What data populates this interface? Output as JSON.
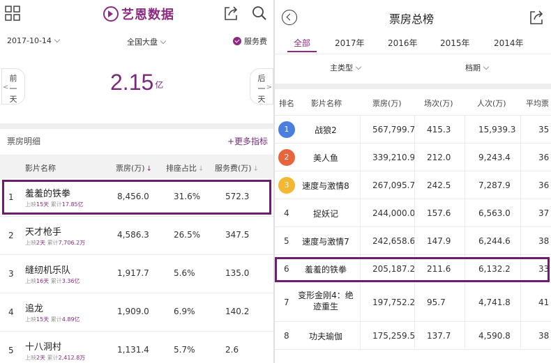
{
  "left": {
    "app_title": "艺恩数据",
    "date": "2017-10-14",
    "market": "全国大盘",
    "fee_toggle": "服务费",
    "prev_day": [
      "前",
      "一",
      "天"
    ],
    "next_day": [
      "后",
      "一",
      "天"
    ],
    "total_value": "2.15",
    "total_unit": "亿",
    "section_title": "票房明细",
    "more_metrics": "+更多指标",
    "headers": {
      "film": "影片名称",
      "box": "票房(万)",
      "share": "排座占比",
      "fee": "服务费(万)"
    },
    "sort_arrows": [
      "↓",
      "↓",
      "↓"
    ],
    "rows": [
      {
        "rank": "1",
        "title": "羞羞的铁拳",
        "days_pre": "上映",
        "days": "15天",
        "cum_pre": " 累计",
        "cum": "17.85亿",
        "box": "8,456.0",
        "share": "31.6%",
        "fee": "572.3"
      },
      {
        "rank": "2",
        "title": "天才枪手",
        "days_pre": "上映",
        "days": "2天",
        "cum_pre": " 累计",
        "cum": "7,706.2万",
        "box": "4,586.3",
        "share": "26.5%",
        "fee": "347.5"
      },
      {
        "rank": "3",
        "title": "缝纫机乐队",
        "days_pre": "上映",
        "days": "16天",
        "cum_pre": " 累计",
        "cum": "3.36亿",
        "box": "1,917.7",
        "share": "5.6%",
        "fee": "135.0"
      },
      {
        "rank": "4",
        "title": "追龙",
        "days_pre": "上映",
        "days": "15天",
        "cum_pre": " 累计",
        "cum": "4.89亿",
        "box": "1,909.0",
        "share": "6.9%",
        "fee": "140.2"
      },
      {
        "rank": "5",
        "title": "十八洞村",
        "days_pre": "上映",
        "days": "2天",
        "cum_pre": " 累计",
        "cum": "2,412.8万",
        "box": "1,131.4",
        "share": "5.7%",
        "fee": "2.6"
      }
    ]
  },
  "right": {
    "title": "票房总榜",
    "tabs": [
      "全部",
      "2017年",
      "2016年",
      "2015年",
      "2014年"
    ],
    "filter_genre": "主类型",
    "filter_period": "档期",
    "headers": {
      "rank": "排名",
      "film": "影片名称",
      "box": "票房(万)",
      "shows": "场次(万)",
      "viewers": "人次(万)",
      "avg": "平均票"
    },
    "rows": [
      {
        "rank": "1",
        "title": "战狼2",
        "box": "567,799.7",
        "shows": "415.3",
        "viewers": "15,939.3",
        "avg": "35"
      },
      {
        "rank": "2",
        "title": "美人鱼",
        "box": "339,210.9",
        "shows": "212.0",
        "viewers": "9,243.4",
        "avg": "36"
      },
      {
        "rank": "3",
        "title": "速度与激情8",
        "box": "267,095.7",
        "shows": "242.5",
        "viewers": "7,287.9",
        "avg": "36"
      },
      {
        "rank": "4",
        "title": "捉妖记",
        "box": "244,000.0",
        "shows": "157.6",
        "viewers": "6,563.0",
        "avg": "37"
      },
      {
        "rank": "5",
        "title": "速度与激情7",
        "box": "242,658.6",
        "shows": "147.9",
        "viewers": "6,244.6",
        "avg": "38"
      },
      {
        "rank": "6",
        "title": "羞羞的铁拳",
        "box": "205,187.2",
        "shows": "211.6",
        "viewers": "6,132.2",
        "avg": "33"
      },
      {
        "rank": "7",
        "title": "变形金刚4：绝迹重生",
        "box": "197,752.2",
        "shows": "95.7",
        "viewers": "4,741.8",
        "avg": "41"
      },
      {
        "rank": "8",
        "title": "功夫瑜伽",
        "box": "175,259.5",
        "shows": "137.7",
        "viewers": "4,590.8",
        "avg": "38"
      }
    ]
  },
  "colors": {
    "brand": "#8c2a82",
    "highlight_box": "#6b1e6b",
    "medal_gold": "#f4b731",
    "medal_silver": "#e8643c",
    "medal_blue": "#4a7fe0"
  }
}
